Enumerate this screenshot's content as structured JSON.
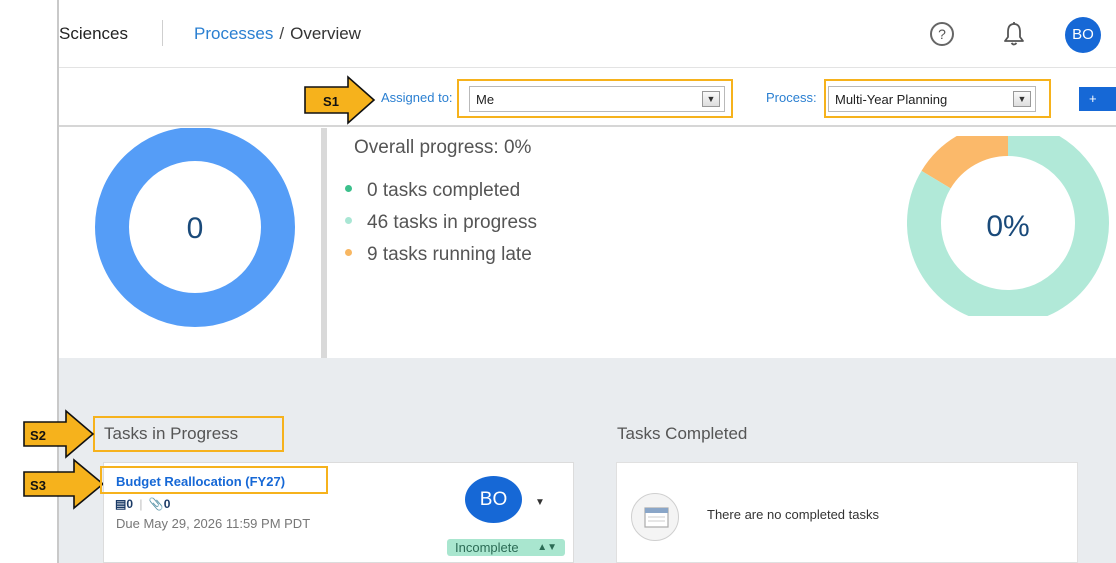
{
  "header": {
    "brand": "Sciences",
    "breadcrumb_link": "Processes",
    "breadcrumb_sep": "/",
    "breadcrumb_current": "Overview",
    "help_glyph": "?",
    "avatar_initials": "BO"
  },
  "filters": {
    "assigned_label": "Assigned to:",
    "assigned_value": "Me",
    "process_label": "Process:",
    "process_value": "Multi-Year Planning",
    "add_label": "+"
  },
  "callouts": {
    "s1": "S1",
    "s2": "S2",
    "s3": "S3"
  },
  "stats": {
    "count_value": "0",
    "progress_title": "Overall progress: 0%",
    "legend": [
      {
        "label": "0 tasks completed",
        "color": "#3cc08c"
      },
      {
        "label": "46 tasks in progress",
        "color": "#a9e6d4"
      },
      {
        "label": "9 tasks running late",
        "color": "#f8b762"
      }
    ],
    "progress_percent": "0%",
    "donut_colors": {
      "count_ring": "#559df7",
      "in_progress": "#b1e9d8",
      "late": "#fbb96a",
      "callout": "#f6b21c"
    },
    "donut_segments": {
      "in_progress": 46,
      "late": 9,
      "completed": 0
    }
  },
  "sections": {
    "in_progress_title": "Tasks in Progress",
    "completed_title": "Tasks Completed"
  },
  "task": {
    "title": "Budget Reallocation (FY27)",
    "docs_count": "0",
    "attachments_count": "0",
    "due": "Due May 29, 2026 11:59 PM PDT",
    "assignee_initials": "BO",
    "status": "Incomplete"
  },
  "completed": {
    "empty_text": "There are no completed tasks"
  }
}
